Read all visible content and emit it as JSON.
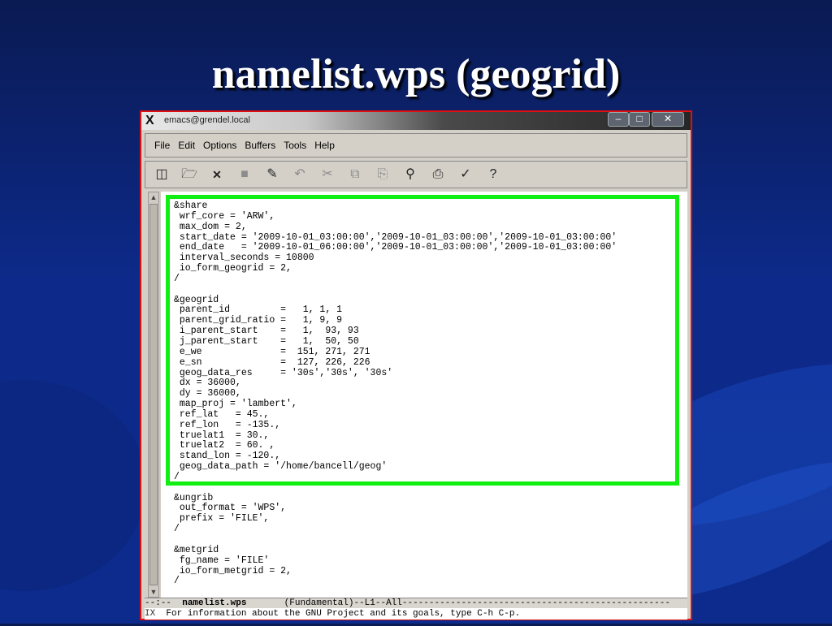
{
  "slide": {
    "title": "namelist.wps (geogrid)"
  },
  "window": {
    "title": "emacs@grendel.local",
    "minimize": "‒",
    "maximize": "□",
    "close": "✕"
  },
  "menubar": {
    "items": [
      "File",
      "Edit",
      "Options",
      "Buffers",
      "Tools",
      "Help"
    ]
  },
  "toolbar": {
    "icons": [
      "new-file-icon",
      "open-folder-icon",
      "close-buffer-icon",
      "save-icon",
      "save-as-icon",
      "undo-icon",
      "cut-icon",
      "copy-icon",
      "paste-icon",
      "search-icon",
      "print-icon",
      "preferences-icon",
      "help-icon"
    ]
  },
  "editor": {
    "content": "&share\n wrf_core = 'ARW',\n max_dom = 2,\n start_date = '2009-10-01_03:00:00','2009-10-01_03:00:00','2009-10-01_03:00:00'\n end_date   = '2009-10-01_06:00:00','2009-10-01_03:00:00','2009-10-01_03:00:00'\n interval_seconds = 10800\n io_form_geogrid = 2,\n/\n\n&geogrid\n parent_id         =   1, 1, 1\n parent_grid_ratio =   1, 9, 9\n i_parent_start    =   1,  93, 93\n j_parent_start    =   1,  50, 50\n e_we              =  151, 271, 271\n e_sn              =  127, 226, 226\n geog_data_res     = '30s','30s', '30s'\n dx = 36000,\n dy = 36000,\n map_proj = 'lambert',\n ref_lat   = 45.,\n ref_lon   = -135.,\n truelat1  = 30.,\n truelat2  = 60. ,\n stand_lon = -120.,\n geog_data_path = '/home/bancell/geog'\n/\n\n&ungrib\n out_format = 'WPS',\n prefix = 'FILE',\n/\n\n&metgrid\n fg_name = 'FILE'\n io_form_metgrid = 2,\n/",
    "highlight_color": "#11ee11"
  },
  "modeline": {
    "prefix": "--:--  ",
    "buffer_name": "namelist.wps",
    "rest": "       (Fundamental)--L1--All--------------------------------------------------"
  },
  "echo_area": {
    "corner": "IX",
    "text": "For information about the GNU Project and its goals, type C-h C-p."
  }
}
